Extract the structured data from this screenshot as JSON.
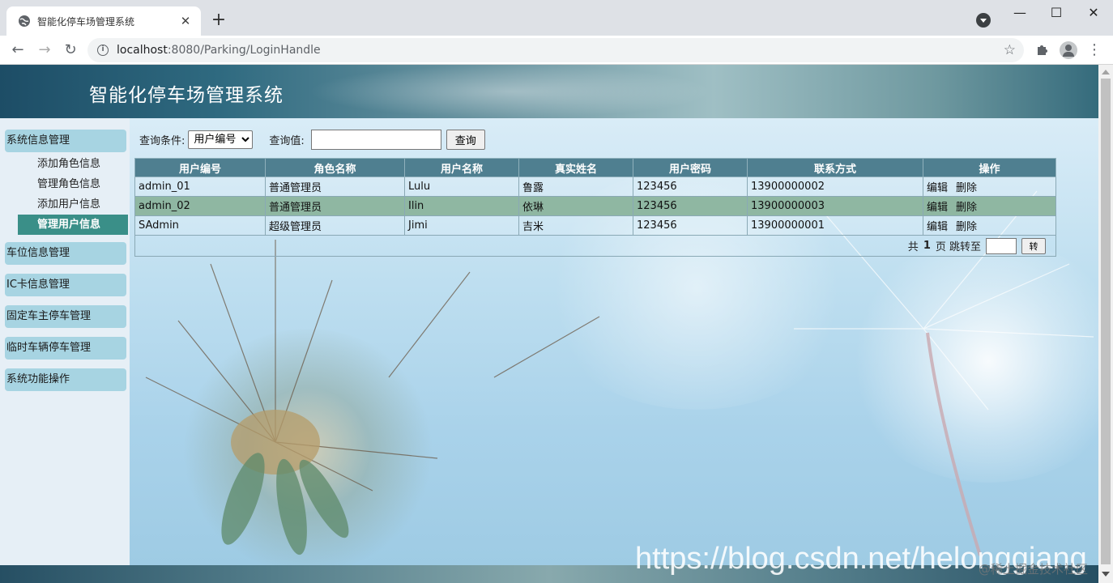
{
  "browser": {
    "tab_title": "智能化停车场管理系统",
    "url_host": "localhost",
    "url_path": ":8080/Parking/LoginHandle",
    "new_tab": "+",
    "min": "—",
    "max": "☐",
    "close": "✕",
    "tab_close": "✕"
  },
  "site": {
    "title": "智能化停车场管理系统"
  },
  "sidebar": {
    "groups": [
      {
        "label": "系统信息管理"
      },
      {
        "label": "车位信息管理"
      },
      {
        "label": "IC卡信息管理"
      },
      {
        "label": "固定车主停车管理"
      },
      {
        "label": "临时车辆停车管理"
      },
      {
        "label": "系统功能操作"
      }
    ],
    "subitems": [
      {
        "label": "添加角色信息"
      },
      {
        "label": "管理角色信息"
      },
      {
        "label": "添加用户信息"
      },
      {
        "label": "管理用户信息",
        "active": true
      }
    ]
  },
  "query": {
    "condition_label": "查询条件:",
    "condition_selected": "用户编号",
    "value_label": "查询值:",
    "value": "",
    "submit": "查询"
  },
  "table": {
    "headers": [
      "用户编号",
      "角色名称",
      "用户名称",
      "真实姓名",
      "用户密码",
      "联系方式",
      "操作"
    ],
    "rows": [
      {
        "id": "admin_01",
        "role": "普通管理员",
        "username": "Lulu",
        "realname": "鲁露",
        "password": "123456",
        "phone": "13900000002",
        "edit": "编辑",
        "delete": "删除"
      },
      {
        "id": "admin_02",
        "role": "普通管理员",
        "username": "Ilin",
        "realname": "依琳",
        "password": "123456",
        "phone": "13900000003",
        "edit": "编辑",
        "delete": "删除"
      },
      {
        "id": "SAdmin",
        "role": "超级管理员",
        "username": "Jimi",
        "realname": "吉米",
        "password": "123456",
        "phone": "13900000001",
        "edit": "编辑",
        "delete": "删除"
      }
    ]
  },
  "pager": {
    "prefix": "共",
    "total": "1",
    "pages_suffix": "页 跳转至",
    "goto_value": "",
    "go_button": "转"
  },
  "watermark": {
    "text": "https://blog.csdn.net/helonggiang",
    "sub": "@稀土掘金技术社区"
  }
}
